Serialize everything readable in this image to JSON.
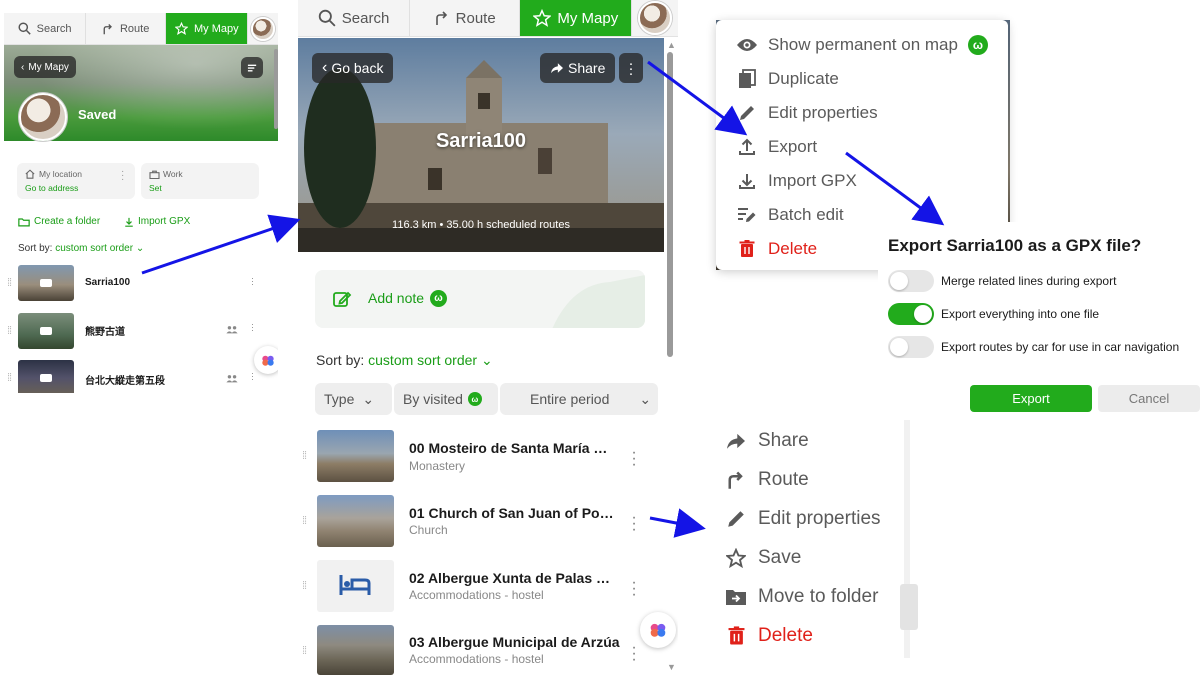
{
  "tabs": {
    "search": "Search",
    "route": "Route",
    "my_mapy": "My Mapy"
  },
  "panel_small": {
    "back_label": "My Mapy",
    "folder_title": "Saved",
    "locations": [
      {
        "name": "My location",
        "action": "Go to address"
      },
      {
        "name": "Work",
        "action": "Set"
      }
    ],
    "create_folder": "Create a folder",
    "import_gpx": "Import GPX",
    "sort_label": "Sort by:",
    "sort_value": "custom sort order",
    "items": [
      {
        "title": "Sarria100"
      },
      {
        "title": "熊野古道"
      },
      {
        "title": "台北大縱走第五段"
      }
    ]
  },
  "panel_main": {
    "back_label": "Go back",
    "share_label": "Share",
    "route_title": "Sarria100",
    "route_stats": "116.3 km • 35.00 h scheduled routes",
    "add_note": "Add note",
    "sort_label": "Sort by:",
    "sort_value": "custom sort order",
    "filters": {
      "type": "Type",
      "visited": "By visited",
      "period": "Entire period"
    },
    "items": [
      {
        "title": "00 Mosteiro de Santa María M...",
        "subtitle": "Monastery"
      },
      {
        "title": "01 Church of San Juan of Por...",
        "subtitle": "Church"
      },
      {
        "title": "02 Albergue Xunta de Palas d...",
        "subtitle": "Accommodations - hostel"
      },
      {
        "title": "03 Albergue Municipal de Arzúa",
        "subtitle": "Accommodations - hostel"
      }
    ]
  },
  "route_menu": {
    "items": [
      {
        "label": "Show permanent on map",
        "icon": "eye-icon"
      },
      {
        "label": "Duplicate",
        "icon": "duplicate-icon"
      },
      {
        "label": "Edit properties",
        "icon": "pencil-icon"
      },
      {
        "label": "Export",
        "icon": "upload-icon"
      },
      {
        "label": "Import GPX",
        "icon": "download-icon"
      },
      {
        "label": "Batch edit",
        "icon": "batch-edit-icon"
      },
      {
        "label": "Delete",
        "icon": "trash-icon"
      }
    ]
  },
  "export_dialog": {
    "title": "Export Sarria100 as a GPX file?",
    "options": [
      {
        "label": "Merge related lines during export",
        "on": false
      },
      {
        "label": "Export everything into one file",
        "on": true
      },
      {
        "label": "Export routes by car for use in car navigation",
        "on": false
      }
    ],
    "export_button": "Export",
    "cancel_button": "Cancel"
  },
  "item_menu": {
    "items": [
      {
        "label": "Share",
        "icon": "share-icon"
      },
      {
        "label": "Route",
        "icon": "route-icon"
      },
      {
        "label": "Edit properties",
        "icon": "pencil-icon"
      },
      {
        "label": "Save",
        "icon": "star-icon"
      },
      {
        "label": "Move to folder",
        "icon": "folder-move-icon"
      },
      {
        "label": "Delete",
        "icon": "trash-icon"
      }
    ]
  },
  "colors": {
    "accent_green": "#22ab1c",
    "delete_red": "#e0211a",
    "annotation_arrow": "#1414e6"
  }
}
